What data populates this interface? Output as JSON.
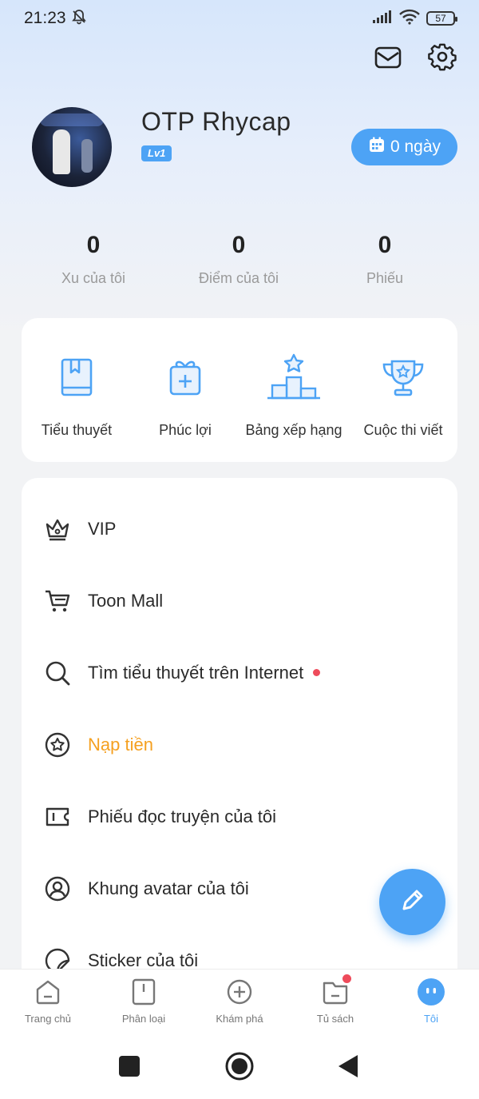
{
  "status_bar": {
    "time": "21:23",
    "battery": "57"
  },
  "profile": {
    "username": "OTP Rhycap",
    "level": "Lv1",
    "checkin_label": "0 ngày"
  },
  "stats": [
    {
      "value": "0",
      "label": "Xu của tôi"
    },
    {
      "value": "0",
      "label": "Điểm của tôi"
    },
    {
      "value": "0",
      "label": "Phiếu"
    }
  ],
  "quick_actions": [
    {
      "label": "Tiểu thuyết",
      "icon": "book-icon"
    },
    {
      "label": "Phúc lợi",
      "icon": "gift-icon"
    },
    {
      "label": "Bảng xếp hạng",
      "icon": "podium-icon"
    },
    {
      "label": "Cuộc thi viết",
      "icon": "trophy-icon"
    }
  ],
  "menu": [
    {
      "label": "VIP",
      "icon": "crown-icon"
    },
    {
      "label": "Toon Mall",
      "icon": "cart-icon"
    },
    {
      "label": "Tìm tiểu thuyết trên Internet",
      "icon": "search-icon",
      "has_dot": true
    },
    {
      "label": "Nạp tiền",
      "icon": "coin-star-icon",
      "highlight_color": "#f5a020"
    },
    {
      "label": "Phiếu đọc truyện của tôi",
      "icon": "ticket-icon"
    },
    {
      "label": "Khung avatar của tôi",
      "icon": "avatar-frame-icon"
    },
    {
      "label": "Sticker của tôi",
      "icon": "sticker-icon"
    }
  ],
  "tabbar": [
    {
      "label": "Trang chủ",
      "icon": "home-icon"
    },
    {
      "label": "Phân loại",
      "icon": "category-icon"
    },
    {
      "label": "Khám phá",
      "icon": "explore-icon"
    },
    {
      "label": "Tủ sách",
      "icon": "bookshelf-icon",
      "has_dot": true
    },
    {
      "label": "Tôi",
      "icon": "me-icon",
      "active": true
    }
  ],
  "colors": {
    "accent": "#4da3f5",
    "highlight": "#f5a020",
    "dot": "#ee4b5b"
  }
}
